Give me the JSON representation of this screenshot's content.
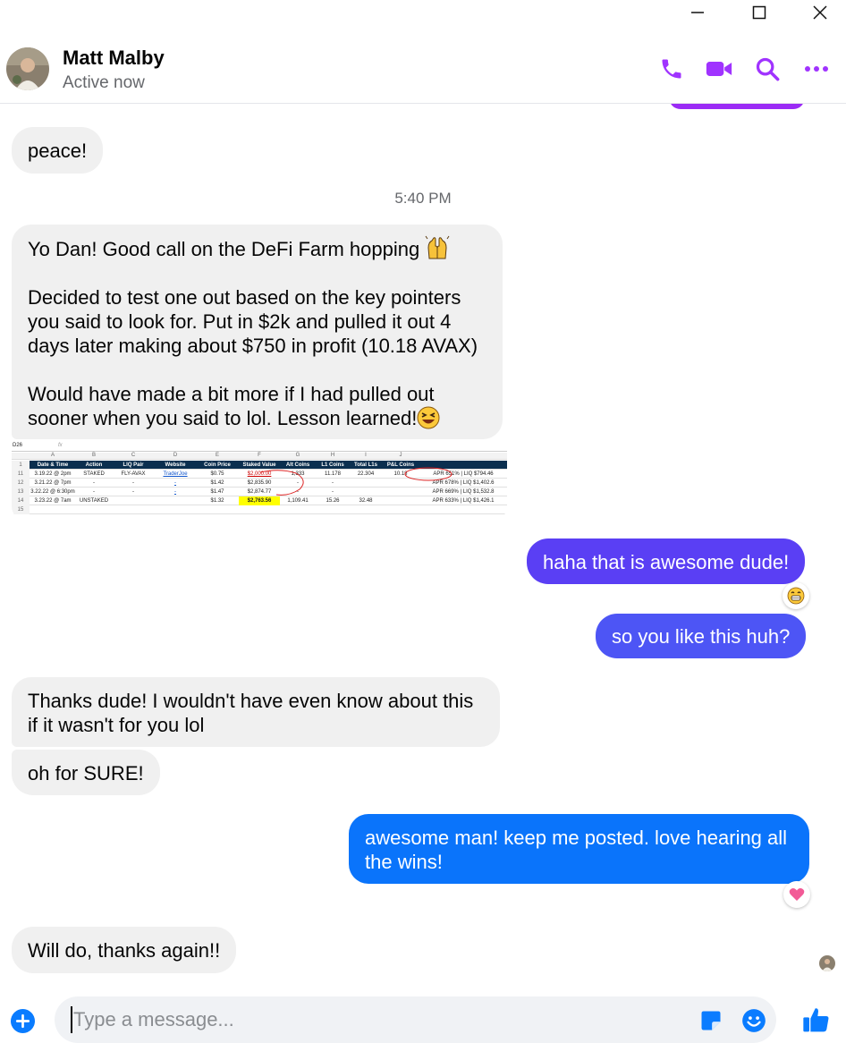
{
  "window": {
    "min_label": "minimize",
    "max_label": "maximize",
    "close_label": "close"
  },
  "header": {
    "name": "Matt Malby",
    "status": "Active now",
    "icons": [
      "phone-icon",
      "video-icon",
      "search-icon",
      "more-icon"
    ]
  },
  "colors": {
    "accent": "#a033ff",
    "outgoing_bubbles": [
      "#5a3ff4",
      "#4d55f5",
      "#0a74fb"
    ],
    "incoming_bubble": "#f0f0f0",
    "composer_icon": "#0a7cff"
  },
  "messages": {
    "peace": "peace!",
    "timestamp": "5:40 PM",
    "long_p1": "Yo Dan! Good call on the DeFi Farm hopping",
    "long_p2": "Decided to test one out based on the key pointers you said to look for. Put in $2k and pulled it out 4 days later making about $750 in profit (10.18 AVAX)",
    "long_p3": "Would have made a bit more if I had pulled out sooner when you said to lol. Lesson learned!",
    "haha": "haha that is awesome dude!",
    "like_this": "so you like this huh?",
    "thanks": "Thanks dude! I wouldn't have even know about this if it wasn't for you lol",
    "for_sure": "oh for SURE!",
    "awesome": "awesome man! keep me posted. love hearing all the wins!",
    "will_do": "Will do, thanks again!!"
  },
  "reactions": {
    "haha": "grinning-emoji",
    "awesome": "heart-emoji"
  },
  "spreadsheet": {
    "cell_ref": "D26",
    "fx": "fx",
    "col_letters": [
      "A",
      "B",
      "C",
      "D",
      "E",
      "F",
      "G",
      "H",
      "I",
      "J"
    ],
    "headers": [
      "Date & Time",
      "Action",
      "LIQ Pair",
      "Website",
      "Coin Price",
      "Staked Value",
      "Alt Coins",
      "L1 Coins",
      "Total L1s",
      "P&L Coins"
    ],
    "row_numbers": [
      "1",
      "11",
      "12",
      "13",
      "14",
      "15"
    ],
    "rows": [
      [
        "3.19.22 @ 2pm",
        "STAKED",
        "FLY-AVAX",
        "TraderJoe",
        "$0.75",
        "$2,000.00",
        "1,333",
        "11.178",
        "22.304",
        "10.18",
        "APR 651% | LIQ $794.46"
      ],
      [
        "3.21.22 @ 7pm",
        "-",
        "-",
        "-",
        "$1.42",
        "$2,835.90",
        "-",
        "-",
        "",
        "",
        "APR 678% | LIQ $1,402.6"
      ],
      [
        "3.22.22 @ 6:30pm",
        "-",
        "-",
        "-",
        "$1.47",
        "$2,874.77",
        "-",
        "-",
        "",
        "",
        "APR 669% | LIQ $1,532.8"
      ],
      [
        "3.23.22 @ 7am",
        "UNSTAKED",
        "",
        "",
        "$1.32",
        "$2,763.56",
        "1,109.41",
        "15.26",
        "32.48",
        "",
        "APR 633% | LIQ $1,426.1"
      ]
    ]
  },
  "composer": {
    "placeholder": "Type a message..."
  }
}
